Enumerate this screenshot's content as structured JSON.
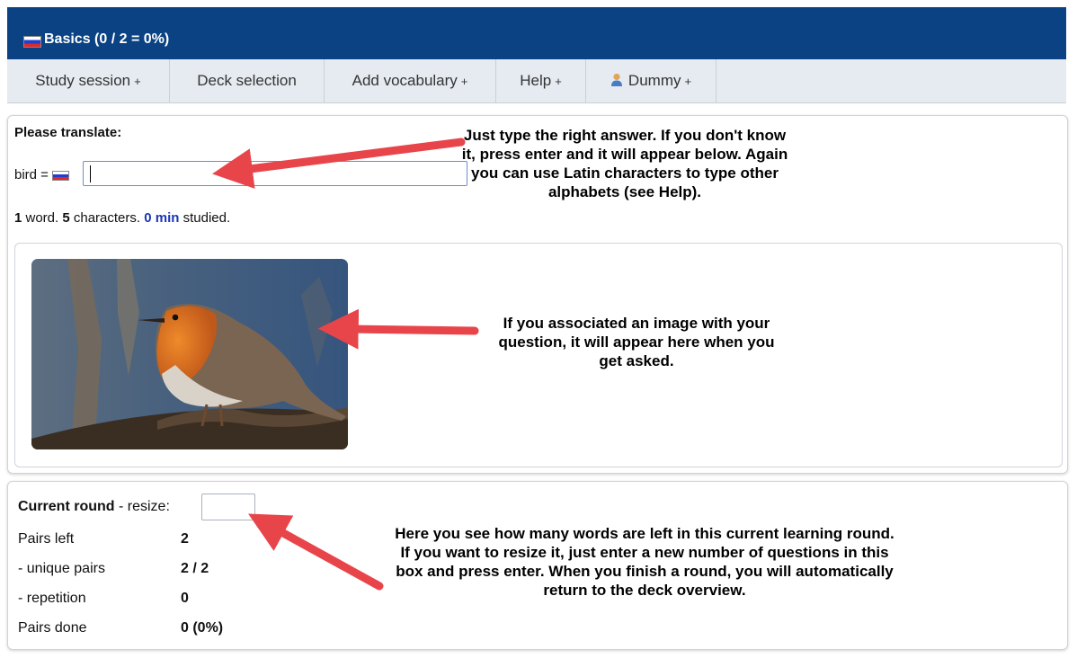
{
  "header": {
    "title": "Basics (0 / 2 = 0%)",
    "flag_icon": "russian-flag-icon"
  },
  "menu": {
    "items": [
      {
        "label": "Study session",
        "suffix": "+"
      },
      {
        "label": "Deck selection",
        "suffix": ""
      },
      {
        "label": "Add vocabulary",
        "suffix": "+"
      },
      {
        "label": "Help",
        "suffix": "+"
      },
      {
        "label": "Dummy",
        "suffix": "+",
        "icon": "user-icon"
      }
    ]
  },
  "question": {
    "heading": "Please translate:",
    "word": "bird =",
    "answer_value": "",
    "stats": {
      "words_count": "1",
      "words_label": " word. ",
      "chars_count": "5",
      "chars_label": " characters. ",
      "time": "0 min",
      "time_label": " studied."
    }
  },
  "image": {
    "subject": "robin bird photo"
  },
  "annotations": {
    "answer_tip": "Just type the right answer. If you don't know it, press enter and it will appear below. Again you can use Latin characters to type other alphabets (see Help).",
    "image_tip": "If you associated an image with your question, it will appear here when you get asked.",
    "round_tip": "Here you see how many words are left in this current learning round. If you want to resize it, just enter a new number of questions in this box and press enter. When you finish a round, you will automatically return to the deck overview."
  },
  "round": {
    "title": "Current round",
    "resize_label": " - resize:",
    "resize_value": "",
    "rows": [
      {
        "label": "Pairs left",
        "value": "2"
      },
      {
        "label": " - unique pairs",
        "value": "2 / 2"
      },
      {
        "label": " - repetition",
        "value": "0"
      },
      {
        "label": "Pairs done",
        "value": "0 (0%)"
      }
    ]
  },
  "colors": {
    "header_bg": "#0a4283",
    "menu_bg": "#e6ebf1",
    "accent_blue": "#1a37b5",
    "arrow_red": "#e8454a"
  }
}
